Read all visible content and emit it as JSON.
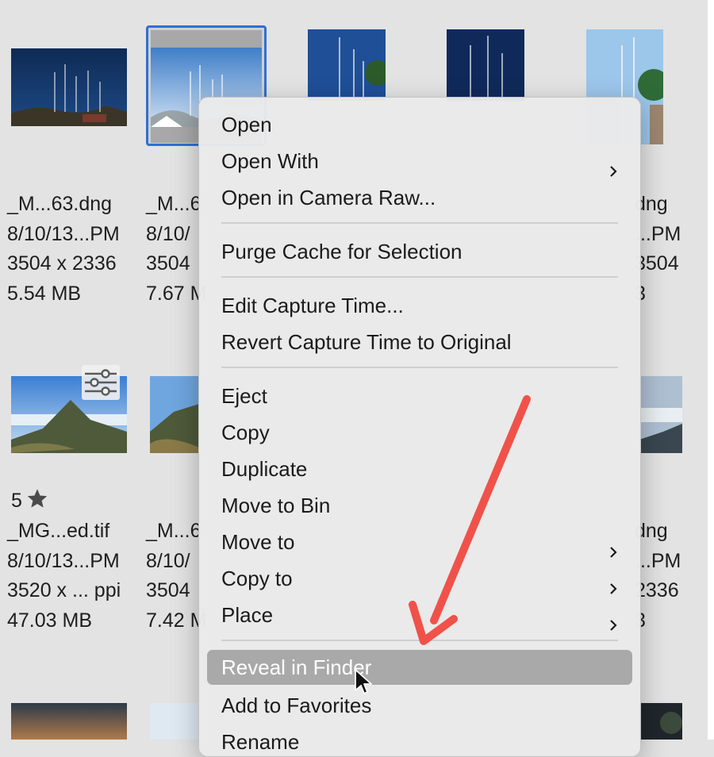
{
  "files": [
    {
      "name": "_M...63.dng",
      "date": "8/10/13...PM",
      "dimensions": "3504 x 2336",
      "size": "5.54 MB"
    },
    {
      "name": "_M...6",
      "date": "8/10/",
      "dimensions": "3504",
      "size": "7.67 M"
    },
    {
      "name": "dng",
      "date": "...PM",
      "dimensions": "3504",
      "size": "3"
    },
    {
      "rating": "5",
      "name": "_MG...ed.tif",
      "date": "8/10/13...PM",
      "dimensions": "3520 x ... ppi",
      "size": "47.03 MB"
    },
    {
      "name": "_M...6",
      "date": "8/10/",
      "dimensions": "3504",
      "size": "7.42 M"
    },
    {
      "name": "dng",
      "date": "...PM",
      "dimensions": "2336",
      "size": "3"
    }
  ],
  "menu": {
    "items": [
      {
        "label": "Open",
        "submenu": false
      },
      {
        "label": "Open With",
        "submenu": true
      },
      {
        "label": "Open in Camera Raw...",
        "submenu": false
      },
      {
        "label": "Purge Cache for Selection",
        "submenu": false
      },
      {
        "label": "Edit Capture Time...",
        "submenu": false
      },
      {
        "label": "Revert Capture Time to Original",
        "submenu": false
      },
      {
        "label": "Eject",
        "submenu": false
      },
      {
        "label": "Copy",
        "submenu": false
      },
      {
        "label": "Duplicate",
        "submenu": false
      },
      {
        "label": "Move to Bin",
        "submenu": false
      },
      {
        "label": "Move to",
        "submenu": true
      },
      {
        "label": "Copy to",
        "submenu": true
      },
      {
        "label": "Place",
        "submenu": true
      },
      {
        "label": "Reveal in Finder",
        "submenu": false,
        "highlighted": true
      },
      {
        "label": "Add to Favorites",
        "submenu": false
      },
      {
        "label": "Rename",
        "submenu": false
      }
    ]
  },
  "icons": [
    "sliders-icon",
    "star-icon",
    "chevron-right-icon",
    "mouse-pointer-icon",
    "annotation-arrow"
  ],
  "colors": {
    "selection": "#2f6fd6",
    "highlight": "#a9a9a9",
    "annotation": "#f0524a"
  }
}
